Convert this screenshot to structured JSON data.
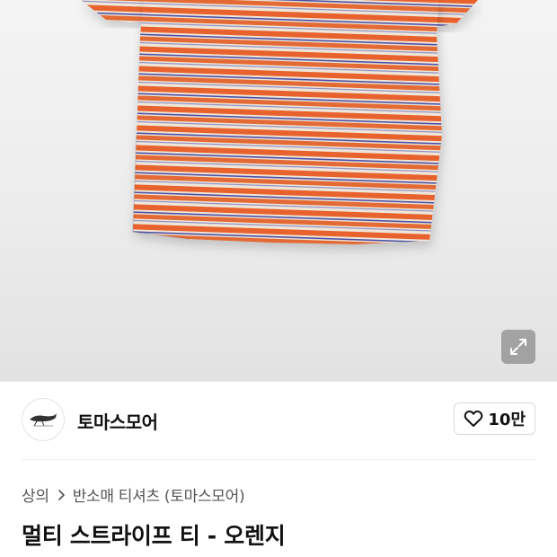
{
  "product_image": {
    "alt": "멀티 스트라이프 티 - 오렌지",
    "stripe_colors": [
      "#e8622e",
      "#efe4d6",
      "#4b4fa6"
    ]
  },
  "expand_icon": "expand-arrows-icon",
  "brand": {
    "name": "토마스모어",
    "logo_icon": "whale-logo-icon"
  },
  "like": {
    "icon": "heart-outline-icon",
    "count": "10만"
  },
  "breadcrumb": {
    "category": "상의",
    "separator_icon": "chevron-right-icon",
    "subcategory": "반소매 티셔츠 (토마스모어)"
  },
  "product": {
    "title": "멀티 스트라이프 티 - 오렌지"
  }
}
